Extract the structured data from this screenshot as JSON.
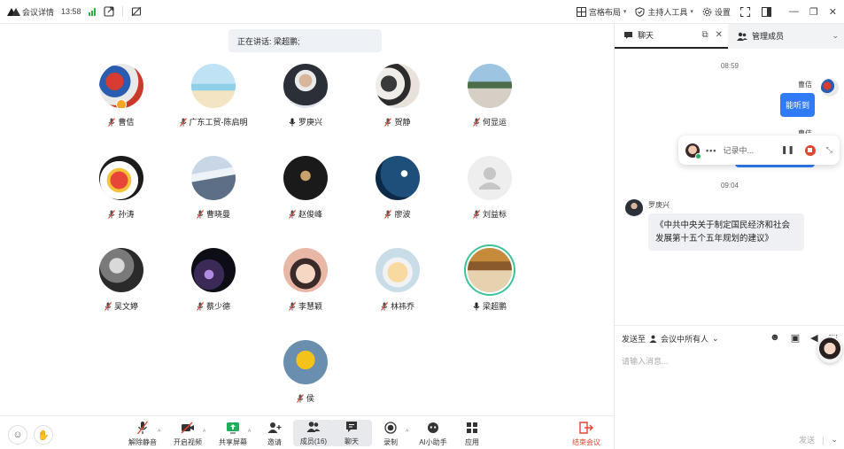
{
  "topbar": {
    "app_title": "会议详情",
    "time": "13:58",
    "layout_label": "宫格布局",
    "host_tools_label": "主持人工具",
    "settings_label": "设置"
  },
  "speaking": {
    "text": "正在讲话: 梁超鹏;"
  },
  "participants": [
    {
      "name": "曹佶",
      "mic": "muted",
      "host": true
    },
    {
      "name": "广东工贸-陈启明",
      "mic": "muted"
    },
    {
      "name": "罗庚兴",
      "mic": "on"
    },
    {
      "name": "贺静",
      "mic": "muted"
    },
    {
      "name": "何显运",
      "mic": "muted"
    },
    {
      "name": "孙涛",
      "mic": "muted"
    },
    {
      "name": "曹晓曼",
      "mic": "muted"
    },
    {
      "name": "赵俊峰",
      "mic": "muted"
    },
    {
      "name": "廖波",
      "mic": "muted"
    },
    {
      "name": "刘益标",
      "mic": "muted"
    },
    {
      "name": "吴文婷",
      "mic": "muted"
    },
    {
      "name": "蔡少德",
      "mic": "muted"
    },
    {
      "name": "李慧颖",
      "mic": "muted"
    },
    {
      "name": "林祎乔",
      "mic": "muted"
    },
    {
      "name": "梁超鹏",
      "mic": "on",
      "speaking": true
    },
    {
      "name": "侯",
      "mic": "muted"
    }
  ],
  "toolbar": {
    "unmute": "解除静音",
    "video": "开启视频",
    "share": "共享屏幕",
    "invite": "邀请",
    "members": "成员(16)",
    "chat": "聊天",
    "record": "录制",
    "ai": "AI小助手",
    "apps": "应用",
    "end": "结束会议"
  },
  "panel": {
    "tab_chat": "聊天",
    "tab_members": "管理成员",
    "time1": "08:59",
    "sender1": "曹佶",
    "msg1": "能听到",
    "sender2_partial": "曹佶",
    "recording_text": "记录中...",
    "time2": "09:04",
    "sender3": "罗庚兴",
    "msg3": "《中共中央关于制定国民经济和社会发展第十五个五年规划的建议》",
    "send_to_label": "发送至",
    "send_to_value": "会议中所有人",
    "input_placeholder": "请输入消息...",
    "send_label": "发送"
  },
  "colors": {
    "accent_blue": "#2f7cf6",
    "end_red": "#e5442f",
    "signal_green": "#2fb44a",
    "speaking_ring": "#3cc39a"
  }
}
